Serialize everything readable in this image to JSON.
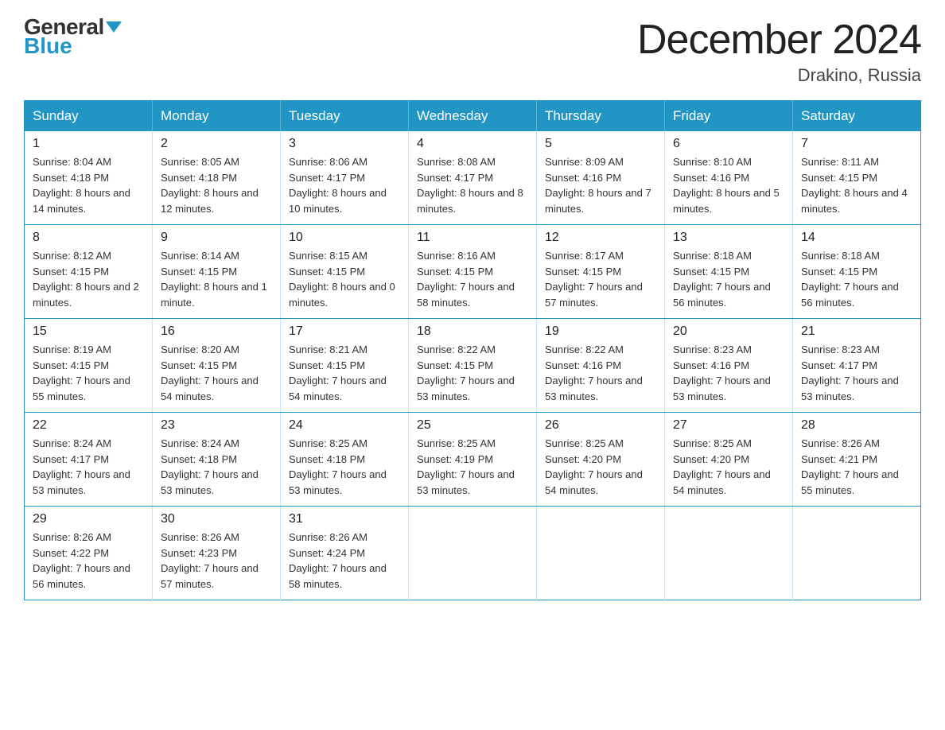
{
  "logo": {
    "general": "General",
    "blue": "Blue"
  },
  "title": "December 2024",
  "location": "Drakino, Russia",
  "weekdays": [
    "Sunday",
    "Monday",
    "Tuesday",
    "Wednesday",
    "Thursday",
    "Friday",
    "Saturday"
  ],
  "weeks": [
    [
      {
        "day": "1",
        "sunrise": "8:04 AM",
        "sunset": "4:18 PM",
        "daylight": "8 hours and 14 minutes."
      },
      {
        "day": "2",
        "sunrise": "8:05 AM",
        "sunset": "4:18 PM",
        "daylight": "8 hours and 12 minutes."
      },
      {
        "day": "3",
        "sunrise": "8:06 AM",
        "sunset": "4:17 PM",
        "daylight": "8 hours and 10 minutes."
      },
      {
        "day": "4",
        "sunrise": "8:08 AM",
        "sunset": "4:17 PM",
        "daylight": "8 hours and 8 minutes."
      },
      {
        "day": "5",
        "sunrise": "8:09 AM",
        "sunset": "4:16 PM",
        "daylight": "8 hours and 7 minutes."
      },
      {
        "day": "6",
        "sunrise": "8:10 AM",
        "sunset": "4:16 PM",
        "daylight": "8 hours and 5 minutes."
      },
      {
        "day": "7",
        "sunrise": "8:11 AM",
        "sunset": "4:15 PM",
        "daylight": "8 hours and 4 minutes."
      }
    ],
    [
      {
        "day": "8",
        "sunrise": "8:12 AM",
        "sunset": "4:15 PM",
        "daylight": "8 hours and 2 minutes."
      },
      {
        "day": "9",
        "sunrise": "8:14 AM",
        "sunset": "4:15 PM",
        "daylight": "8 hours and 1 minute."
      },
      {
        "day": "10",
        "sunrise": "8:15 AM",
        "sunset": "4:15 PM",
        "daylight": "8 hours and 0 minutes."
      },
      {
        "day": "11",
        "sunrise": "8:16 AM",
        "sunset": "4:15 PM",
        "daylight": "7 hours and 58 minutes."
      },
      {
        "day": "12",
        "sunrise": "8:17 AM",
        "sunset": "4:15 PM",
        "daylight": "7 hours and 57 minutes."
      },
      {
        "day": "13",
        "sunrise": "8:18 AM",
        "sunset": "4:15 PM",
        "daylight": "7 hours and 56 minutes."
      },
      {
        "day": "14",
        "sunrise": "8:18 AM",
        "sunset": "4:15 PM",
        "daylight": "7 hours and 56 minutes."
      }
    ],
    [
      {
        "day": "15",
        "sunrise": "8:19 AM",
        "sunset": "4:15 PM",
        "daylight": "7 hours and 55 minutes."
      },
      {
        "day": "16",
        "sunrise": "8:20 AM",
        "sunset": "4:15 PM",
        "daylight": "7 hours and 54 minutes."
      },
      {
        "day": "17",
        "sunrise": "8:21 AM",
        "sunset": "4:15 PM",
        "daylight": "7 hours and 54 minutes."
      },
      {
        "day": "18",
        "sunrise": "8:22 AM",
        "sunset": "4:15 PM",
        "daylight": "7 hours and 53 minutes."
      },
      {
        "day": "19",
        "sunrise": "8:22 AM",
        "sunset": "4:16 PM",
        "daylight": "7 hours and 53 minutes."
      },
      {
        "day": "20",
        "sunrise": "8:23 AM",
        "sunset": "4:16 PM",
        "daylight": "7 hours and 53 minutes."
      },
      {
        "day": "21",
        "sunrise": "8:23 AM",
        "sunset": "4:17 PM",
        "daylight": "7 hours and 53 minutes."
      }
    ],
    [
      {
        "day": "22",
        "sunrise": "8:24 AM",
        "sunset": "4:17 PM",
        "daylight": "7 hours and 53 minutes."
      },
      {
        "day": "23",
        "sunrise": "8:24 AM",
        "sunset": "4:18 PM",
        "daylight": "7 hours and 53 minutes."
      },
      {
        "day": "24",
        "sunrise": "8:25 AM",
        "sunset": "4:18 PM",
        "daylight": "7 hours and 53 minutes."
      },
      {
        "day": "25",
        "sunrise": "8:25 AM",
        "sunset": "4:19 PM",
        "daylight": "7 hours and 53 minutes."
      },
      {
        "day": "26",
        "sunrise": "8:25 AM",
        "sunset": "4:20 PM",
        "daylight": "7 hours and 54 minutes."
      },
      {
        "day": "27",
        "sunrise": "8:25 AM",
        "sunset": "4:20 PM",
        "daylight": "7 hours and 54 minutes."
      },
      {
        "day": "28",
        "sunrise": "8:26 AM",
        "sunset": "4:21 PM",
        "daylight": "7 hours and 55 minutes."
      }
    ],
    [
      {
        "day": "29",
        "sunrise": "8:26 AM",
        "sunset": "4:22 PM",
        "daylight": "7 hours and 56 minutes."
      },
      {
        "day": "30",
        "sunrise": "8:26 AM",
        "sunset": "4:23 PM",
        "daylight": "7 hours and 57 minutes."
      },
      {
        "day": "31",
        "sunrise": "8:26 AM",
        "sunset": "4:24 PM",
        "daylight": "7 hours and 58 minutes."
      },
      null,
      null,
      null,
      null
    ]
  ]
}
